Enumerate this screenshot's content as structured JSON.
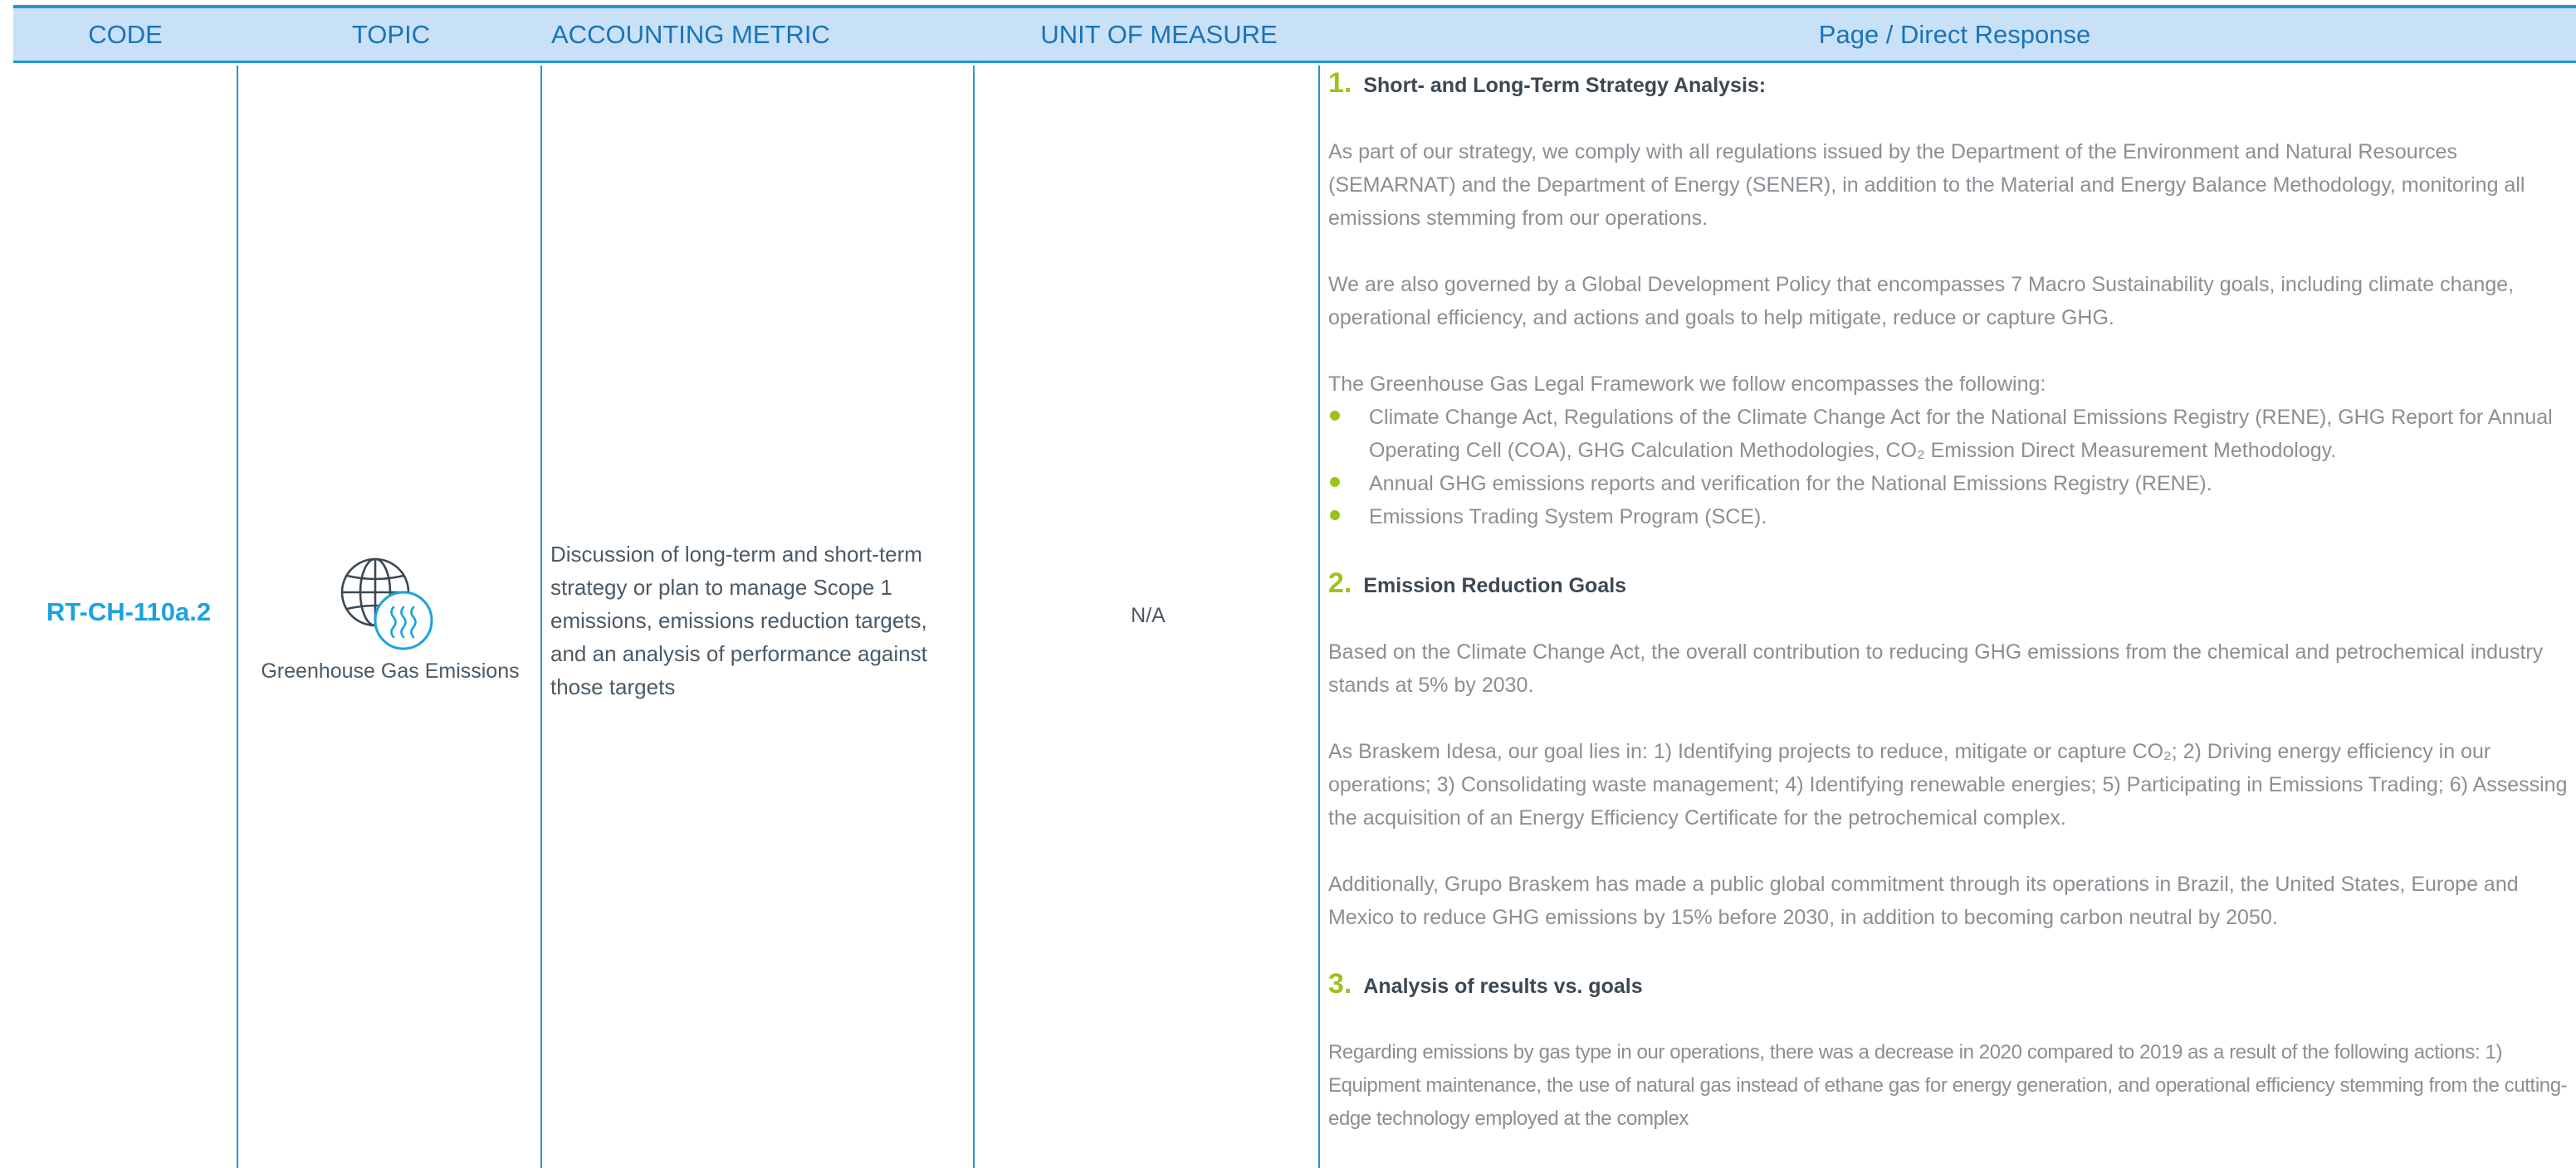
{
  "header": {
    "code": "CODE",
    "topic": "TOPIC",
    "metric": "ACCOUNTING METRIC",
    "unit": "UNIT OF MEASURE",
    "response": "Page / Direct Response"
  },
  "row": {
    "code": "RT-CH-110a.2",
    "topic_icon": "greenhouse-gas-globe-icon",
    "topic": "Greenhouse Gas Emissions",
    "metric": "Discussion of long-term and short-term strategy or plan to manage Scope 1 emissions, emissions reduction targets, and an analysis of performance against those targets",
    "unit": "N/A"
  },
  "response": {
    "s1": {
      "num": "1.",
      "title": "Short- and Long-Term Strategy Analysis:",
      "p1": "As part of our strategy, we comply with all regulations issued by the Department of the Environment and Natural Resources (SEMARNAT) and the Department of Energy (SENER), in addition to the Material and Energy Balance Methodology, monitoring all emissions stemming from our operations.",
      "p2": "We are also governed by a Global Development Policy that encompasses 7 Macro Sustainability goals, including climate change, operational efficiency, and actions and goals to help mitigate, reduce or capture GHG.",
      "p3": "The Greenhouse Gas Legal Framework we follow encompasses the following:",
      "bullets": [
        "Climate Change Act, Regulations of the Climate Change Act for the National Emissions Registry (RENE), GHG Report for Annual Operating Cell (COA), GHG Calculation Methodologies, CO₂ Emission Direct Measurement Methodology.",
        "Annual GHG emissions reports and verification for the National Emissions Registry (RENE).",
        "Emissions Trading System Program (SCE)."
      ]
    },
    "s2": {
      "num": "2.",
      "title": "Emission Reduction Goals",
      "p1": "Based on the Climate Change Act, the overall contribution to reducing GHG emissions from the chemical and petrochemical industry stands at 5% by 2030.",
      "p2": "As Braskem Idesa, our goal lies in: 1) Identifying projects to reduce, mitigate or capture CO₂; 2) Driving energy efficiency in our operations; 3) Consolidating waste management; 4) Identifying renewable energies; 5) Participating in Emissions Trading; 6) Assessing the acquisition of an Energy Efficiency Certificate for the petrochemical complex.",
      "p3": "Additionally, Grupo Braskem has made a public global commitment through its operations in Brazil, the United States, Europe and Mexico to reduce GHG emissions by 15% before 2030, in addition to becoming carbon neutral by 2050."
    },
    "s3": {
      "num": "3.",
      "title": "Analysis of results vs. goals",
      "p1": "Regarding emissions by gas type in our operations, there was a decrease in 2020 compared to 2019 as a result of the following actions: 1) Equipment maintenance, the use of natural gas instead of ethane gas for energy generation, and operational efficiency stemming from the cutting-edge technology employed at the complex"
    }
  },
  "colors": {
    "header_bg": "#c9e1f7",
    "rule": "#2196d3",
    "header_text": "#1a73b8",
    "code_text": "#1aa3e0",
    "accent_green": "#9bc31c",
    "body_text": "#8a8f94"
  }
}
